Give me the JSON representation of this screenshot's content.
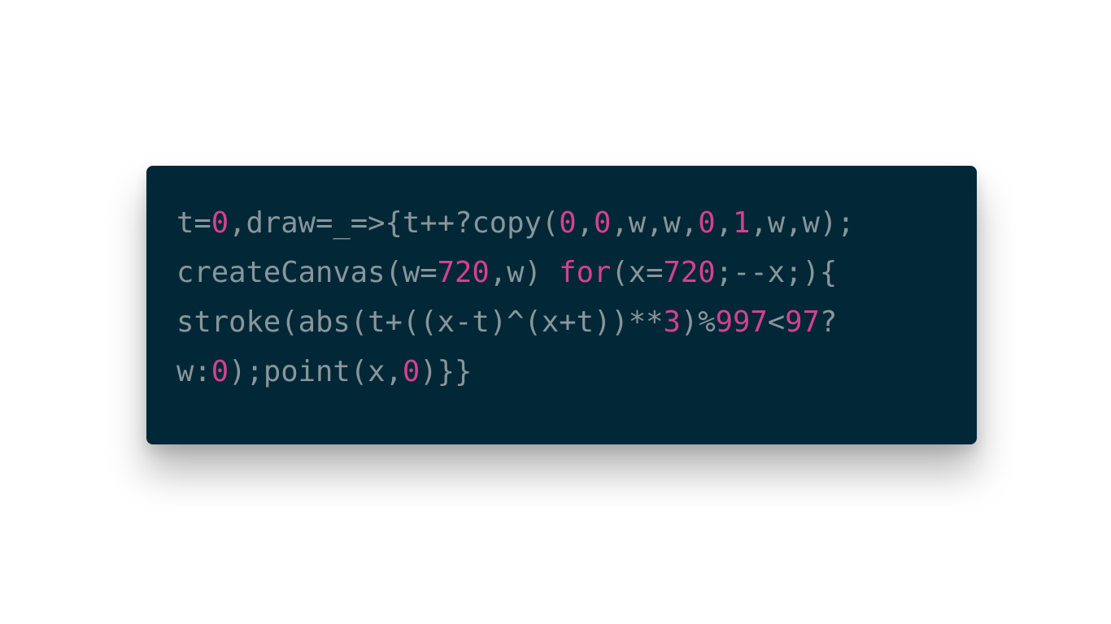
{
  "code": {
    "colors": {
      "background": "#022838",
      "plain": "#8a959a",
      "number": "#d6418f",
      "keyword": "#d6418f"
    },
    "lines": [
      [
        {
          "t": "t=",
          "k": "plain"
        },
        {
          "t": "0",
          "k": "num"
        },
        {
          "t": ",draw=_=>{t++?copy(",
          "k": "plain"
        },
        {
          "t": "0",
          "k": "num"
        },
        {
          "t": ",",
          "k": "plain"
        },
        {
          "t": "0",
          "k": "num"
        },
        {
          "t": ",w,w,",
          "k": "plain"
        },
        {
          "t": "0",
          "k": "num"
        },
        {
          "t": ",",
          "k": "plain"
        },
        {
          "t": "1",
          "k": "num"
        },
        {
          "t": ",w,w);",
          "k": "plain"
        }
      ],
      [
        {
          "t": "createCanvas(w=",
          "k": "plain"
        },
        {
          "t": "720",
          "k": "num"
        },
        {
          "t": ",w) ",
          "k": "plain"
        },
        {
          "t": "for",
          "k": "kw"
        },
        {
          "t": "(x=",
          "k": "plain"
        },
        {
          "t": "720",
          "k": "num"
        },
        {
          "t": ";--x;){",
          "k": "plain"
        }
      ],
      [
        {
          "t": "stroke(abs(t+((x-t)^(x+t))**",
          "k": "plain"
        },
        {
          "t": "3",
          "k": "num"
        },
        {
          "t": ")%",
          "k": "plain"
        },
        {
          "t": "997",
          "k": "num"
        },
        {
          "t": "<",
          "k": "plain"
        },
        {
          "t": "97",
          "k": "num"
        },
        {
          "t": "?",
          "k": "plain"
        }
      ],
      [
        {
          "t": "w:",
          "k": "plain"
        },
        {
          "t": "0",
          "k": "num"
        },
        {
          "t": ");point(x,",
          "k": "plain"
        },
        {
          "t": "0",
          "k": "num"
        },
        {
          "t": ")}}",
          "k": "plain"
        }
      ]
    ]
  }
}
